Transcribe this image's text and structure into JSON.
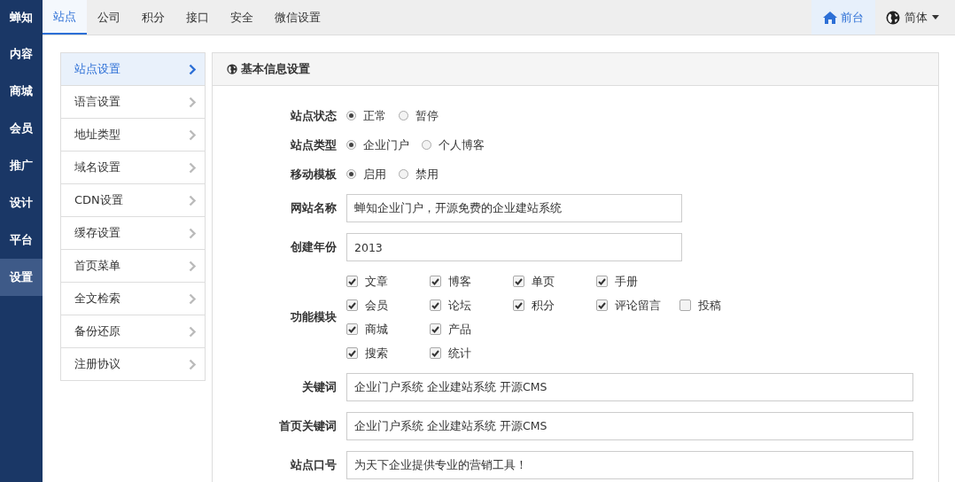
{
  "brand": "蝉知",
  "nav": [
    {
      "label": "内容",
      "selected": false
    },
    {
      "label": "商城",
      "selected": false
    },
    {
      "label": "会员",
      "selected": false
    },
    {
      "label": "推广",
      "selected": false
    },
    {
      "label": "设计",
      "selected": false
    },
    {
      "label": "平台",
      "selected": false
    },
    {
      "label": "设置",
      "selected": true
    }
  ],
  "tabs": [
    {
      "label": "站点",
      "selected": true
    },
    {
      "label": "公司",
      "selected": false
    },
    {
      "label": "积分",
      "selected": false
    },
    {
      "label": "接口",
      "selected": false
    },
    {
      "label": "安全",
      "selected": false
    },
    {
      "label": "微信设置",
      "selected": false
    }
  ],
  "front_link": {
    "label": "前台",
    "selected": true
  },
  "language": {
    "label": "简体"
  },
  "side_menu": [
    {
      "label": "站点设置",
      "selected": true
    },
    {
      "label": "语言设置",
      "selected": false
    },
    {
      "label": "地址类型",
      "selected": false
    },
    {
      "label": "域名设置",
      "selected": false
    },
    {
      "label": "CDN设置",
      "selected": false
    },
    {
      "label": "缓存设置",
      "selected": false
    },
    {
      "label": "首页菜单",
      "selected": false
    },
    {
      "label": "全文检索",
      "selected": false
    },
    {
      "label": "备份还原",
      "selected": false
    },
    {
      "label": "注册协议",
      "selected": false
    }
  ],
  "panel": {
    "title": "基本信息设置",
    "fields": [
      {
        "kind": "radio",
        "label": "站点状态",
        "options": [
          {
            "label": "正常",
            "selected": true
          },
          {
            "label": "暂停",
            "selected": false
          }
        ]
      },
      {
        "kind": "radio",
        "label": "站点类型",
        "options": [
          {
            "label": "企业门户",
            "selected": true
          },
          {
            "label": "个人博客",
            "selected": false
          }
        ]
      },
      {
        "kind": "radio",
        "label": "移动模板",
        "options": [
          {
            "label": "启用",
            "selected": true
          },
          {
            "label": "禁用",
            "selected": false
          }
        ]
      },
      {
        "kind": "text",
        "label": "网站名称",
        "value": "蝉知企业门户，开源免费的企业建站系统"
      },
      {
        "kind": "text",
        "label": "创建年份",
        "value": "2013"
      },
      {
        "kind": "checkboxes",
        "label": "功能模块",
        "rows": [
          [
            {
              "label": "文章",
              "checked": true
            },
            {
              "label": "博客",
              "checked": true
            },
            {
              "label": "单页",
              "checked": true
            },
            {
              "label": "手册",
              "checked": true
            }
          ],
          [
            {
              "label": "会员",
              "checked": true
            },
            {
              "label": "论坛",
              "checked": true
            },
            {
              "label": "积分",
              "checked": true
            },
            {
              "label": "评论留言",
              "checked": true
            },
            {
              "label": "投稿",
              "checked": false
            }
          ],
          [
            {
              "label": "商城",
              "checked": true
            },
            {
              "label": "产品",
              "checked": true
            }
          ],
          [
            {
              "label": "搜索",
              "checked": true
            },
            {
              "label": "统计",
              "checked": true
            }
          ]
        ]
      },
      {
        "kind": "wide-text",
        "label": "关键词",
        "value": "企业门户系统 企业建站系统 开源CMS"
      },
      {
        "kind": "wide-text",
        "label": "首页关键词",
        "value": "企业门户系统 企业建站系统 开源CMS"
      },
      {
        "kind": "wide-text",
        "label": "站点口号",
        "value": "为天下企业提供专业的营销工具！"
      }
    ]
  }
}
